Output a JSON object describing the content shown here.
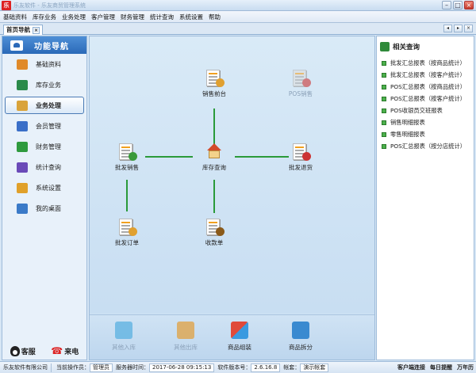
{
  "window": {
    "title": "乐友软件 - 乐友商贸管理系统"
  },
  "menu": [
    "基础资料",
    "库存业务",
    "业务处理",
    "客户管理",
    "财务管理",
    "统计查询",
    "系统设置",
    "帮助"
  ],
  "tab": {
    "label": "首页导航"
  },
  "sidebar": {
    "title": "功能导航",
    "items": [
      {
        "label": "基础资料",
        "color": "#e08a2a"
      },
      {
        "label": "库存业务",
        "color": "#2a8a4a"
      },
      {
        "label": "业务处理",
        "color": "#d9a33a"
      },
      {
        "label": "会员管理",
        "color": "#3a6fc8"
      },
      {
        "label": "财务管理",
        "color": "#2e9a3e"
      },
      {
        "label": "统计查询",
        "color": "#6a4ab8"
      },
      {
        "label": "系统设置",
        "color": "#e0a02a"
      },
      {
        "label": "我的桌面",
        "color": "#3a7ac8"
      }
    ],
    "footer": {
      "service": "客服",
      "call": "来电"
    }
  },
  "flow": {
    "sales_counter": "销售前台",
    "pos_sales": "POS销售",
    "wholesale_sales": "批发销售",
    "stock_query": "库存查询",
    "wholesale_return": "批发退货",
    "wholesale_order": "批发订单",
    "receipt": "收款单"
  },
  "bottom": {
    "other_in": "其他入库",
    "other_out": "其他出库",
    "assemble": "商品组装",
    "split": "商品拆分"
  },
  "related": {
    "title": "相关查询",
    "items": [
      "批发汇总报表（按商品统计）",
      "批发汇总报表（按客户统计）",
      "POS汇总报表（按商品统计）",
      "POS汇总报表（按客户统计）",
      "POS收银员交班报表",
      "销售明细报表",
      "零售明细报表",
      "POS汇总报表（按分店统计）"
    ]
  },
  "status": {
    "company": "乐友软件有限公司",
    "operator_label": "当前操作员：",
    "operator": "管理员",
    "server_time_label": "服务器时间：",
    "server_time": "2017-06-28 09:15:13",
    "version_label": "软件版本号：",
    "version": "2.6.16.8",
    "account_label": "帐套：",
    "account": "演示帐套",
    "client_conn": "客户端连接",
    "daily_reminder": "每日提醒",
    "calendar": "万年历"
  }
}
